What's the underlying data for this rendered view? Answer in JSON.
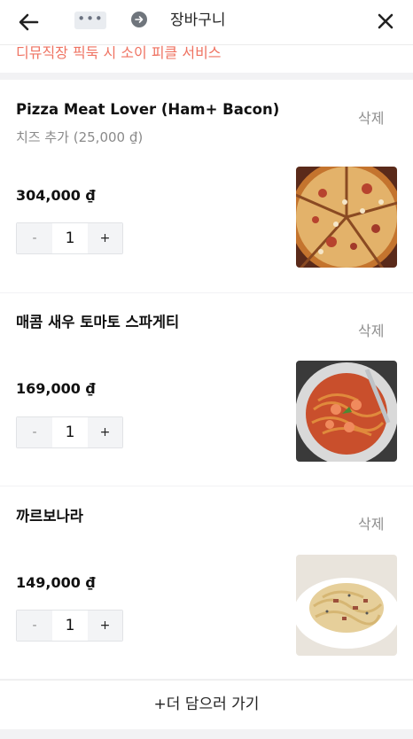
{
  "header": {
    "title": "장바구니",
    "dots": "•••"
  },
  "promo": {
    "text": "디뮤직장 픽둑 시 소이 피클 서비스"
  },
  "items": [
    {
      "name": "Pizza Meat Lover (Ham+ Bacon)",
      "option": "치즈 추가 (25,000 ₫)",
      "price": "304,000 ₫",
      "quantity": "1",
      "delete_label": "삭제",
      "minus_label": "-",
      "plus_label": "+"
    },
    {
      "name": "매콤 새우 토마토 스파게티",
      "price": "169,000 ₫",
      "quantity": "1",
      "delete_label": "삭제",
      "minus_label": "-",
      "plus_label": "+"
    },
    {
      "name": "까르보나라",
      "price": "149,000 ₫",
      "quantity": "1",
      "delete_label": "삭제",
      "minus_label": "-",
      "plus_label": "+"
    }
  ],
  "footer": {
    "add_more_label": "+더 담으러 가기"
  },
  "colors": {
    "promo_text": "#ef7362",
    "muted_text": "#8f8f8f",
    "background": "#f2f2f4"
  }
}
